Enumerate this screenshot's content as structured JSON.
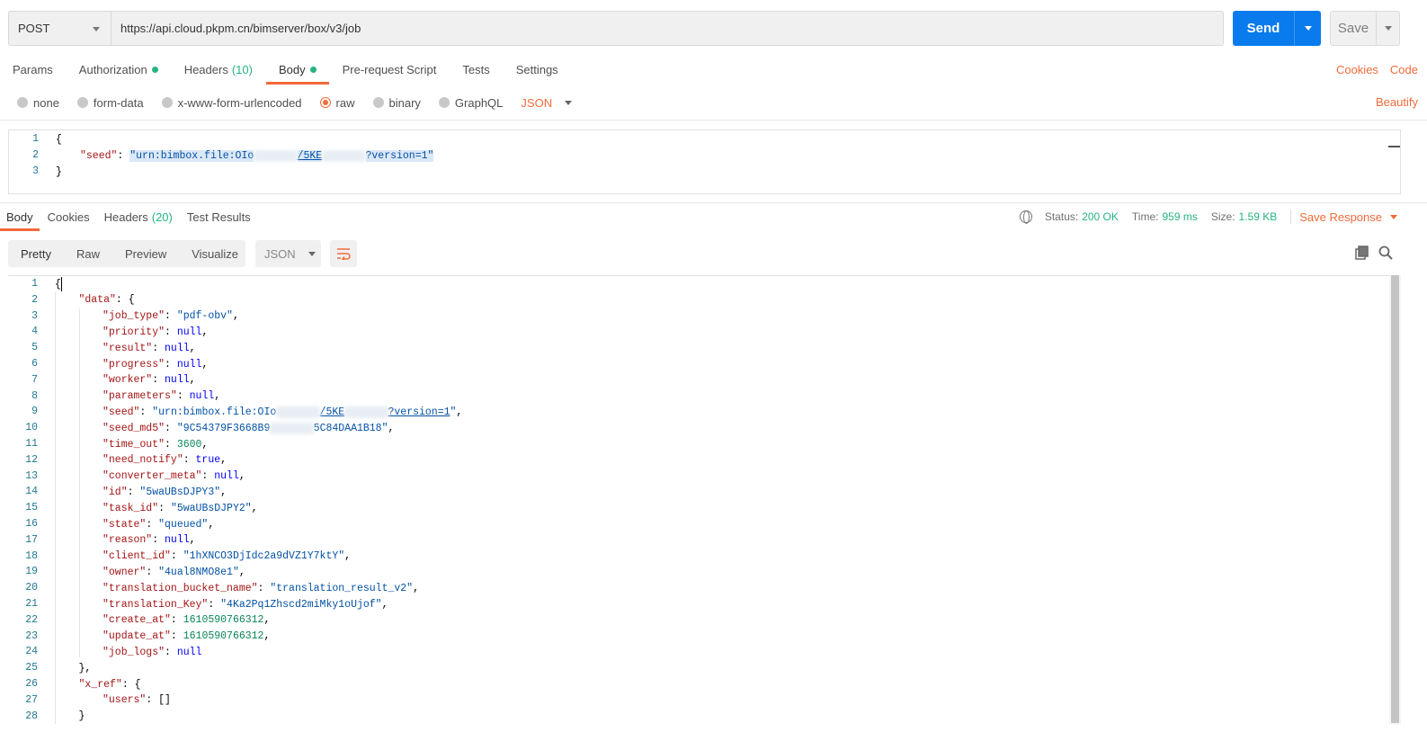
{
  "request": {
    "method": "POST",
    "url": "https://api.cloud.pkpm.cn/bimserver/box/v3/job",
    "send_label": "Send",
    "save_label": "Save"
  },
  "request_tabs": {
    "params": "Params",
    "authorization": "Authorization",
    "headers": "Headers",
    "headers_count": "(10)",
    "body": "Body",
    "prerequest": "Pre-request Script",
    "tests": "Tests",
    "settings": "Settings",
    "cookies_link": "Cookies",
    "code_link": "Code"
  },
  "body_types": {
    "none": "none",
    "form_data": "form-data",
    "urlencoded": "x-www-form-urlencoded",
    "raw": "raw",
    "binary": "binary",
    "graphql": "GraphQL",
    "format": "JSON",
    "beautify": "Beautify"
  },
  "request_body": {
    "l1": "1",
    "l2": "2",
    "l3": "3",
    "open": "{",
    "seed_key": "\"seed\"",
    "seed_prefix": "\"urn:bimbox.file:OIo",
    "seed_mid": "/5KE",
    "seed_suffix": "?version=1\"",
    "close": "}"
  },
  "response_tabs": {
    "body": "Body",
    "cookies": "Cookies",
    "headers": "Headers",
    "headers_count": "(20)",
    "test_results": "Test Results"
  },
  "status": {
    "status_label": "Status:",
    "status_value": "200 OK",
    "time_label": "Time:",
    "time_value": "959 ms",
    "size_label": "Size:",
    "size_value": "1.59 KB",
    "save_response": "Save Response"
  },
  "response_view": {
    "pretty": "Pretty",
    "raw": "Raw",
    "preview": "Preview",
    "visualize": "Visualize",
    "format": "JSON"
  },
  "response_lines": [
    {
      "n": "1",
      "indent": 0,
      "parts": [
        [
          "punct",
          "{"
        ]
      ]
    },
    {
      "n": "2",
      "indent": 1,
      "parts": [
        [
          "key",
          "\"data\""
        ],
        [
          "punct",
          ": {"
        ]
      ]
    },
    {
      "n": "3",
      "indent": 2,
      "parts": [
        [
          "key",
          "\"job_type\""
        ],
        [
          "punct",
          ": "
        ],
        [
          "str",
          "\"pdf-obv\""
        ],
        [
          "punct",
          ","
        ]
      ]
    },
    {
      "n": "4",
      "indent": 2,
      "parts": [
        [
          "key",
          "\"priority\""
        ],
        [
          "punct",
          ": "
        ],
        [
          "kw",
          "null"
        ],
        [
          "punct",
          ","
        ]
      ]
    },
    {
      "n": "5",
      "indent": 2,
      "parts": [
        [
          "key",
          "\"result\""
        ],
        [
          "punct",
          ": "
        ],
        [
          "kw",
          "null"
        ],
        [
          "punct",
          ","
        ]
      ]
    },
    {
      "n": "6",
      "indent": 2,
      "parts": [
        [
          "key",
          "\"progress\""
        ],
        [
          "punct",
          ": "
        ],
        [
          "kw",
          "null"
        ],
        [
          "punct",
          ","
        ]
      ]
    },
    {
      "n": "7",
      "indent": 2,
      "parts": [
        [
          "key",
          "\"worker\""
        ],
        [
          "punct",
          ": "
        ],
        [
          "kw",
          "null"
        ],
        [
          "punct",
          ","
        ]
      ]
    },
    {
      "n": "8",
      "indent": 2,
      "parts": [
        [
          "key",
          "\"parameters\""
        ],
        [
          "punct",
          ": "
        ],
        [
          "kw",
          "null"
        ],
        [
          "punct",
          ","
        ]
      ]
    },
    {
      "n": "9",
      "indent": 2,
      "parts": [
        [
          "key",
          "\"seed\""
        ],
        [
          "punct",
          ": "
        ],
        [
          "str",
          "\"urn:bimbox.file:OIo"
        ],
        [
          "blur",
          "xxxxxxx"
        ],
        [
          "strlink",
          "/5KE"
        ],
        [
          "blur",
          "xxxxxxx"
        ],
        [
          "strlink",
          "?version=1"
        ],
        [
          "str",
          "\""
        ],
        [
          "punct",
          ","
        ]
      ]
    },
    {
      "n": "10",
      "indent": 2,
      "parts": [
        [
          "key",
          "\"seed_md5\""
        ],
        [
          "punct",
          ": "
        ],
        [
          "str",
          "\"9C54379F3668B9"
        ],
        [
          "blur",
          "xxxxxxx"
        ],
        [
          "str",
          "5C84DAA1B18\""
        ],
        [
          "punct",
          ","
        ]
      ]
    },
    {
      "n": "11",
      "indent": 2,
      "parts": [
        [
          "key",
          "\"time_out\""
        ],
        [
          "punct",
          ": "
        ],
        [
          "num",
          "3600"
        ],
        [
          "punct",
          ","
        ]
      ]
    },
    {
      "n": "12",
      "indent": 2,
      "parts": [
        [
          "key",
          "\"need_notify\""
        ],
        [
          "punct",
          ": "
        ],
        [
          "kw",
          "true"
        ],
        [
          "punct",
          ","
        ]
      ]
    },
    {
      "n": "13",
      "indent": 2,
      "parts": [
        [
          "key",
          "\"converter_meta\""
        ],
        [
          "punct",
          ": "
        ],
        [
          "kw",
          "null"
        ],
        [
          "punct",
          ","
        ]
      ]
    },
    {
      "n": "14",
      "indent": 2,
      "parts": [
        [
          "key",
          "\"id\""
        ],
        [
          "punct",
          ": "
        ],
        [
          "str",
          "\"5waUBsDJPY3\""
        ],
        [
          "punct",
          ","
        ]
      ]
    },
    {
      "n": "15",
      "indent": 2,
      "parts": [
        [
          "key",
          "\"task_id\""
        ],
        [
          "punct",
          ": "
        ],
        [
          "str",
          "\"5waUBsDJPY2\""
        ],
        [
          "punct",
          ","
        ]
      ]
    },
    {
      "n": "16",
      "indent": 2,
      "parts": [
        [
          "key",
          "\"state\""
        ],
        [
          "punct",
          ": "
        ],
        [
          "str",
          "\"queued\""
        ],
        [
          "punct",
          ","
        ]
      ]
    },
    {
      "n": "17",
      "indent": 2,
      "parts": [
        [
          "key",
          "\"reason\""
        ],
        [
          "punct",
          ": "
        ],
        [
          "kw",
          "null"
        ],
        [
          "punct",
          ","
        ]
      ]
    },
    {
      "n": "18",
      "indent": 2,
      "parts": [
        [
          "key",
          "\"client_id\""
        ],
        [
          "punct",
          ": "
        ],
        [
          "str",
          "\"1hXNCO3DjIdc2a9dVZ1Y7ktY\""
        ],
        [
          "punct",
          ","
        ]
      ]
    },
    {
      "n": "19",
      "indent": 2,
      "parts": [
        [
          "key",
          "\"owner\""
        ],
        [
          "punct",
          ": "
        ],
        [
          "str",
          "\"4ual8NMO8e1\""
        ],
        [
          "punct",
          ","
        ]
      ]
    },
    {
      "n": "20",
      "indent": 2,
      "parts": [
        [
          "key",
          "\"translation_bucket_name\""
        ],
        [
          "punct",
          ": "
        ],
        [
          "str",
          "\"translation_result_v2\""
        ],
        [
          "punct",
          ","
        ]
      ]
    },
    {
      "n": "21",
      "indent": 2,
      "parts": [
        [
          "key",
          "\"translation_Key\""
        ],
        [
          "punct",
          ": "
        ],
        [
          "str",
          "\"4Ka2Pq1Zhscd2miMky1oUjof\""
        ],
        [
          "punct",
          ","
        ]
      ]
    },
    {
      "n": "22",
      "indent": 2,
      "parts": [
        [
          "key",
          "\"create_at\""
        ],
        [
          "punct",
          ": "
        ],
        [
          "num",
          "1610590766312"
        ],
        [
          "punct",
          ","
        ]
      ]
    },
    {
      "n": "23",
      "indent": 2,
      "parts": [
        [
          "key",
          "\"update_at\""
        ],
        [
          "punct",
          ": "
        ],
        [
          "num",
          "1610590766312"
        ],
        [
          "punct",
          ","
        ]
      ]
    },
    {
      "n": "24",
      "indent": 2,
      "parts": [
        [
          "key",
          "\"job_logs\""
        ],
        [
          "punct",
          ": "
        ],
        [
          "kw",
          "null"
        ]
      ]
    },
    {
      "n": "25",
      "indent": 1,
      "parts": [
        [
          "punct",
          "},"
        ]
      ]
    },
    {
      "n": "26",
      "indent": 1,
      "parts": [
        [
          "key",
          "\"x_ref\""
        ],
        [
          "punct",
          ": {"
        ]
      ]
    },
    {
      "n": "27",
      "indent": 2,
      "parts": [
        [
          "key",
          "\"users\""
        ],
        [
          "punct",
          ": []"
        ]
      ]
    },
    {
      "n": "28",
      "indent": 1,
      "parts": [
        [
          "punct",
          "}"
        ]
      ]
    }
  ],
  "colors": {
    "accent": "#f26b3a",
    "send": "#097bed",
    "success": "#26b47f"
  },
  "icons": [
    "chevron-down-icon",
    "globe-icon",
    "wrap-lines-icon",
    "copy-icon",
    "search-icon"
  ]
}
